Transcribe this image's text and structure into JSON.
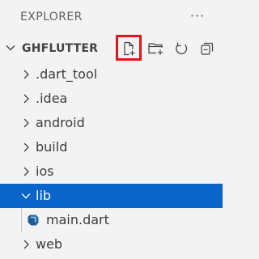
{
  "header": {
    "title": "EXPLORER",
    "more_label": "···"
  },
  "section": {
    "title": "GHFLUTTER",
    "actions": [
      {
        "name": "new-file-icon",
        "tooltip": "New File",
        "highlighted": true
      },
      {
        "name": "new-folder-icon",
        "tooltip": "New Folder",
        "highlighted": false
      },
      {
        "name": "refresh-icon",
        "tooltip": "Refresh Explorer",
        "highlighted": false
      },
      {
        "name": "collapse-all-icon",
        "tooltip": "Collapse Folders in Explorer",
        "highlighted": false
      }
    ]
  },
  "tree": {
    "items": [
      {
        "label": ".dart_tool",
        "kind": "folder",
        "expanded": false,
        "selected": false
      },
      {
        "label": ".idea",
        "kind": "folder",
        "expanded": false,
        "selected": false
      },
      {
        "label": "android",
        "kind": "folder",
        "expanded": false,
        "selected": false
      },
      {
        "label": "build",
        "kind": "folder",
        "expanded": false,
        "selected": false
      },
      {
        "label": "ios",
        "kind": "folder",
        "expanded": false,
        "selected": false
      },
      {
        "label": "lib",
        "kind": "folder",
        "expanded": true,
        "selected": true
      },
      {
        "label": "main.dart",
        "kind": "dart-file",
        "expanded": false,
        "selected": false
      },
      {
        "label": "web",
        "kind": "folder",
        "expanded": false,
        "selected": false
      }
    ]
  },
  "colors": {
    "background": "#f3f3f3",
    "selection": "#0a64c9",
    "highlight_box": "#e0161c",
    "dart_icon": "#2b6fb0"
  }
}
